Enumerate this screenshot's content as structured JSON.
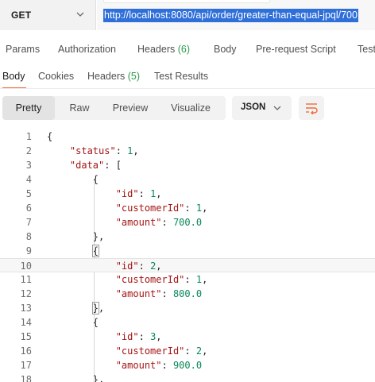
{
  "request": {
    "method": "GET",
    "url": "http://localhost:8080/api/order/greater-than-equal-jpql/700"
  },
  "request_tabs": [
    {
      "label": "Params",
      "count": ""
    },
    {
      "label": "Authorization",
      "count": ""
    },
    {
      "label": "Headers ",
      "count": "(6)"
    },
    {
      "label": "Body",
      "count": ""
    },
    {
      "label": "Pre-request Script",
      "count": ""
    },
    {
      "label": "Tests",
      "count": ""
    }
  ],
  "response_tabs": [
    {
      "label": "Body",
      "count": ""
    },
    {
      "label": "Cookies",
      "count": ""
    },
    {
      "label": "Headers ",
      "count": "(5)"
    },
    {
      "label": "Test Results",
      "count": ""
    }
  ],
  "view_modes": [
    "Pretty",
    "Raw",
    "Preview",
    "Visualize"
  ],
  "active_view_mode": "Pretty",
  "format": "JSON",
  "icons": {
    "method_dropdown": "chevron-down-icon",
    "format_dropdown": "chevron-down-icon",
    "wrap": "wrap-lines-icon"
  },
  "colors": {
    "accent": "#f26b3a",
    "count": "#2e9c4a",
    "url_selection": "#2f6fd9",
    "json_key": "#a31515",
    "json_number": "#098658"
  },
  "code_lines": [
    {
      "n": "1",
      "indent": "",
      "parts": [
        {
          "t": "{",
          "c": "p"
        }
      ]
    },
    {
      "n": "2",
      "indent": "    ",
      "parts": [
        {
          "t": "\"status\"",
          "c": "k"
        },
        {
          "t": ": ",
          "c": "p"
        },
        {
          "t": "1",
          "c": "n"
        },
        {
          "t": ",",
          "c": "p"
        }
      ]
    },
    {
      "n": "3",
      "indent": "    ",
      "parts": [
        {
          "t": "\"data\"",
          "c": "k"
        },
        {
          "t": ": [",
          "c": "p"
        }
      ]
    },
    {
      "n": "4",
      "indent": "        ",
      "parts": [
        {
          "t": "{",
          "c": "p"
        }
      ]
    },
    {
      "n": "5",
      "indent": "            ",
      "parts": [
        {
          "t": "\"id\"",
          "c": "k"
        },
        {
          "t": ": ",
          "c": "p"
        },
        {
          "t": "1",
          "c": "n"
        },
        {
          "t": ",",
          "c": "p"
        }
      ]
    },
    {
      "n": "6",
      "indent": "            ",
      "parts": [
        {
          "t": "\"customerId\"",
          "c": "k"
        },
        {
          "t": ": ",
          "c": "p"
        },
        {
          "t": "1",
          "c": "n"
        },
        {
          "t": ",",
          "c": "p"
        }
      ]
    },
    {
      "n": "7",
      "indent": "            ",
      "parts": [
        {
          "t": "\"amount\"",
          "c": "k"
        },
        {
          "t": ": ",
          "c": "p"
        },
        {
          "t": "700.0",
          "c": "n"
        }
      ]
    },
    {
      "n": "8",
      "indent": "        ",
      "parts": [
        {
          "t": "}",
          "c": "p"
        },
        {
          "t": ",",
          "c": "p"
        }
      ]
    },
    {
      "n": "9",
      "indent": "        ",
      "parts": [
        {
          "t": "{",
          "c": "p box"
        }
      ]
    },
    {
      "n": "10",
      "indent": "            ",
      "parts": [
        {
          "t": "\"id\"",
          "c": "k"
        },
        {
          "t": ": ",
          "c": "p"
        },
        {
          "t": "2",
          "c": "n"
        },
        {
          "t": ",",
          "c": "p"
        }
      ]
    },
    {
      "n": "11",
      "indent": "            ",
      "parts": [
        {
          "t": "\"customerId\"",
          "c": "k"
        },
        {
          "t": ": ",
          "c": "p"
        },
        {
          "t": "1",
          "c": "n"
        },
        {
          "t": ",",
          "c": "p"
        }
      ]
    },
    {
      "n": "12",
      "indent": "            ",
      "parts": [
        {
          "t": "\"amount\"",
          "c": "k"
        },
        {
          "t": ": ",
          "c": "p"
        },
        {
          "t": "800.0",
          "c": "n"
        }
      ]
    },
    {
      "n": "13",
      "indent": "        ",
      "parts": [
        {
          "t": "}",
          "c": "p box"
        },
        {
          "t": ",",
          "c": "p"
        }
      ]
    },
    {
      "n": "14",
      "indent": "        ",
      "parts": [
        {
          "t": "{",
          "c": "p"
        }
      ]
    },
    {
      "n": "15",
      "indent": "            ",
      "parts": [
        {
          "t": "\"id\"",
          "c": "k"
        },
        {
          "t": ": ",
          "c": "p"
        },
        {
          "t": "3",
          "c": "n"
        },
        {
          "t": ",",
          "c": "p"
        }
      ]
    },
    {
      "n": "16",
      "indent": "            ",
      "parts": [
        {
          "t": "\"customerId\"",
          "c": "k"
        },
        {
          "t": ": ",
          "c": "p"
        },
        {
          "t": "2",
          "c": "n"
        },
        {
          "t": ",",
          "c": "p"
        }
      ]
    },
    {
      "n": "17",
      "indent": "            ",
      "parts": [
        {
          "t": "\"amount\"",
          "c": "k"
        },
        {
          "t": ": ",
          "c": "p"
        },
        {
          "t": "900.0",
          "c": "n"
        }
      ]
    },
    {
      "n": "18",
      "indent": "        ",
      "parts": [
        {
          "t": "}",
          "c": "p"
        },
        {
          "t": ",",
          "c": "p"
        }
      ]
    }
  ]
}
